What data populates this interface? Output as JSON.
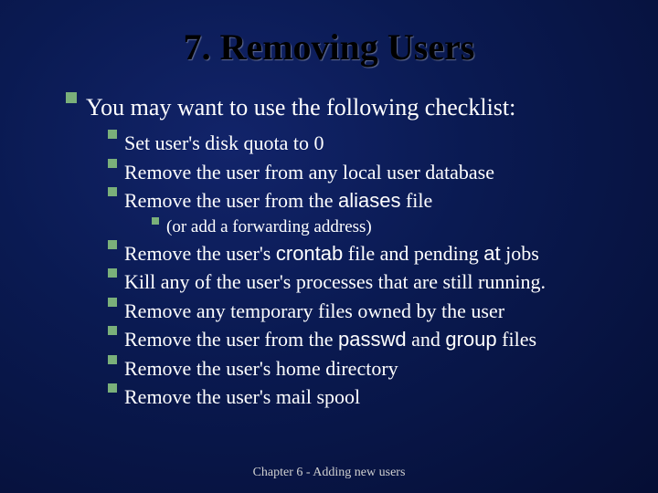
{
  "title": "7. Removing Users",
  "lead": "You may want to use the following checklist:",
  "items_a": [
    "Set user's disk quota to 0",
    "Remove the user from any local user database",
    {
      "pre": "Remove the user from the ",
      "mono": "aliases",
      "post": " file"
    }
  ],
  "sub": "(or add a forwarding address)",
  "items_b": [
    {
      "pre": "Remove the user's ",
      "mono": "crontab",
      "mid": " file and pending ",
      "mono2": "at",
      "post": " jobs"
    },
    "Kill any of the user's processes that are still running.",
    "Remove any temporary files owned by the user",
    {
      "pre": "Remove the user from the ",
      "mono": "passwd",
      "mid": " and ",
      "mono2": "group",
      "post": " files"
    },
    "Remove the user's home directory",
    "Remove the user's mail spool"
  ],
  "footer": "Chapter 6 - Adding new users"
}
